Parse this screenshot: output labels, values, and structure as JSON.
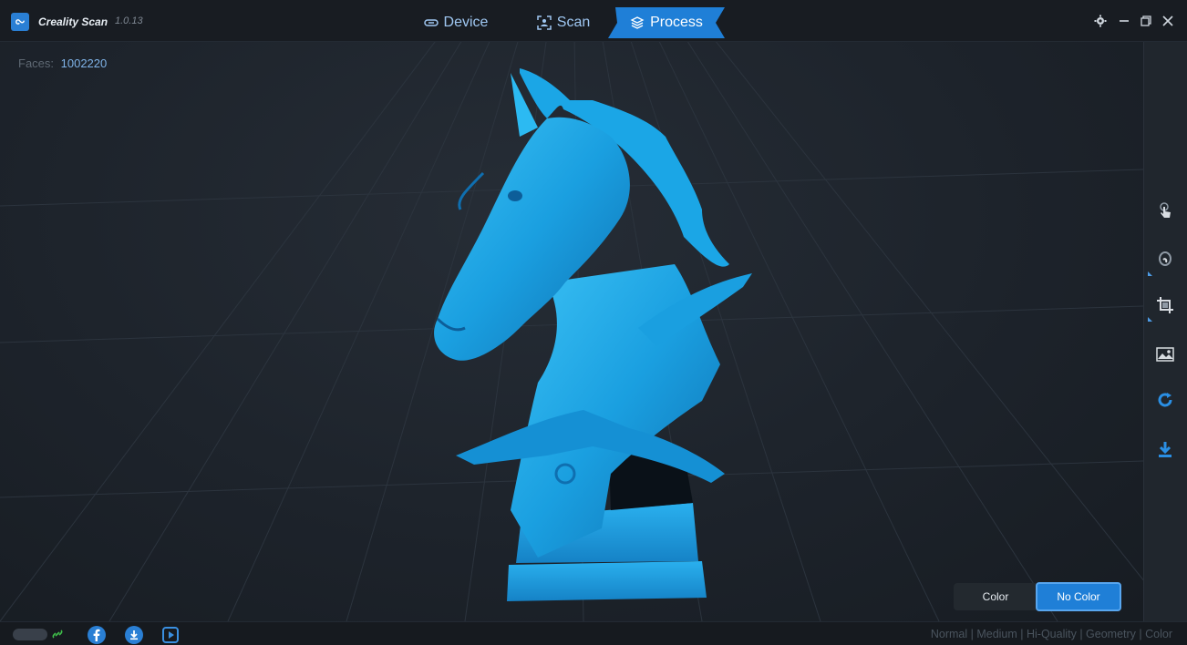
{
  "app": {
    "name": "Creality Scan",
    "version": "1.0.13"
  },
  "nav": {
    "device": "Device",
    "scan": "Scan",
    "process": "Process",
    "active": "Process"
  },
  "viewport": {
    "faces_label": "Faces:",
    "faces_value": "1002220"
  },
  "color_toggle": {
    "color_label": "Color",
    "no_color_label": "No Color",
    "selected": "No Color"
  },
  "right_tools": [
    "touch-hand-icon",
    "lasso-select-icon",
    "crop-icon",
    "texture-image-icon",
    "rotate-refresh-icon",
    "export-download-icon"
  ],
  "status": {
    "quality_modes": "Normal | Medium | Hi-Quality | Geometry | Color"
  },
  "colors": {
    "accent": "#1f7fd7",
    "model": "#1aa3e0",
    "background": "#1d232b"
  }
}
